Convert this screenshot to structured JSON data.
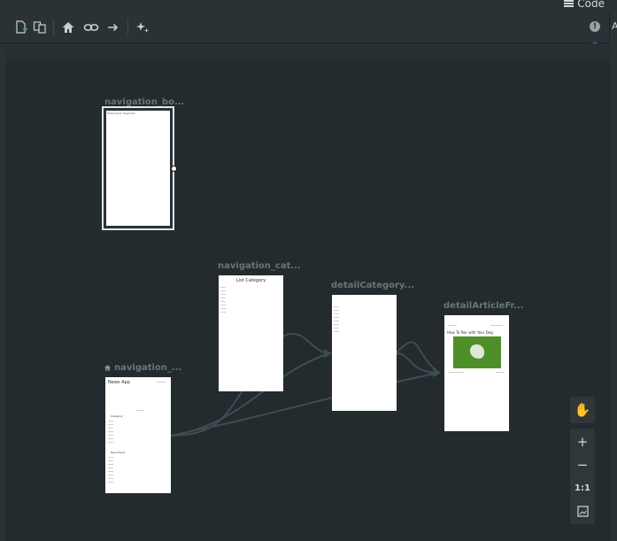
{
  "header": {
    "code_label": "Code",
    "right_strip_letter": "A"
  },
  "toolbar": {
    "icons": [
      "new-destination-icon",
      "duplicate-icon",
      "home-icon",
      "link-icon",
      "action-arrow-icon",
      "sparkle-icon"
    ]
  },
  "status": {
    "warning": "!",
    "help": "?"
  },
  "destinations": [
    {
      "label": "navigation_bo...",
      "is_home": false,
      "content_text": "Hello blank fragment"
    },
    {
      "label": "navigation_cat...",
      "is_home": false,
      "content_title": "List Category"
    },
    {
      "label": "detailCategory...",
      "is_home": false
    },
    {
      "label": "detailArticleFr...",
      "is_home": false,
      "content_title": "How To Pair with Your Dog"
    },
    {
      "label": "navigation_...",
      "is_home": true,
      "content_title": "News App",
      "section_1": "Category",
      "section_2": "New Event"
    }
  ],
  "zoom": {
    "pan": "✋",
    "zoom_in": "+",
    "zoom_out": "−",
    "actual_size": "1:1"
  }
}
